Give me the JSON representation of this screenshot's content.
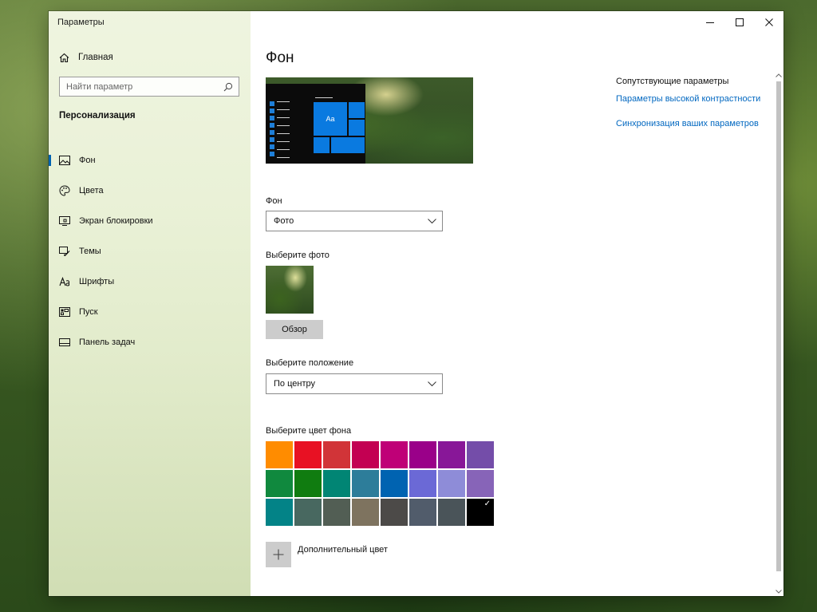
{
  "window": {
    "title": "Параметры"
  },
  "sidebar": {
    "home_label": "Главная",
    "search": {
      "placeholder": "Найти параметр"
    },
    "section_title": "Персонализация",
    "items": [
      {
        "label": "Фон",
        "icon": "image-icon",
        "active": true
      },
      {
        "label": "Цвета",
        "icon": "palette-icon",
        "active": false
      },
      {
        "label": "Экран блокировки",
        "icon": "lock-screen-icon",
        "active": false
      },
      {
        "label": "Темы",
        "icon": "brush-icon",
        "active": false
      },
      {
        "label": "Шрифты",
        "icon": "fonts-icon",
        "active": false
      },
      {
        "label": "Пуск",
        "icon": "start-icon",
        "active": false
      },
      {
        "label": "Панель задач",
        "icon": "taskbar-icon",
        "active": false
      }
    ]
  },
  "main": {
    "title": "Фон",
    "preview": {
      "tile_text": "Aa"
    },
    "background_label": "Фон",
    "background_value": "Фото",
    "choose_photo_label": "Выберите фото",
    "browse_label": "Обзор",
    "position_label": "Выберите положение",
    "position_value": "По центру",
    "color_label": "Выберите цвет фона",
    "colors": [
      "#ff8c00",
      "#e81123",
      "#d13438",
      "#c30052",
      "#bf0077",
      "#9a0089",
      "#881798",
      "#744da9",
      "#10893e",
      "#107c10",
      "#018574",
      "#2d7d9a",
      "#0063b1",
      "#6b69d6",
      "#8e8cd8",
      "#8764b8",
      "#038387",
      "#486860",
      "#525e54",
      "#7e735f",
      "#4c4a48",
      "#515c6b",
      "#4a5459",
      "#000000"
    ],
    "selected_color": "#000000",
    "add_color_label": "Дополнительный цвет"
  },
  "related": {
    "title": "Сопутствующие параметры",
    "links": [
      "Параметры высокой контрастности",
      "Синхронизация ваших параметров"
    ]
  }
}
